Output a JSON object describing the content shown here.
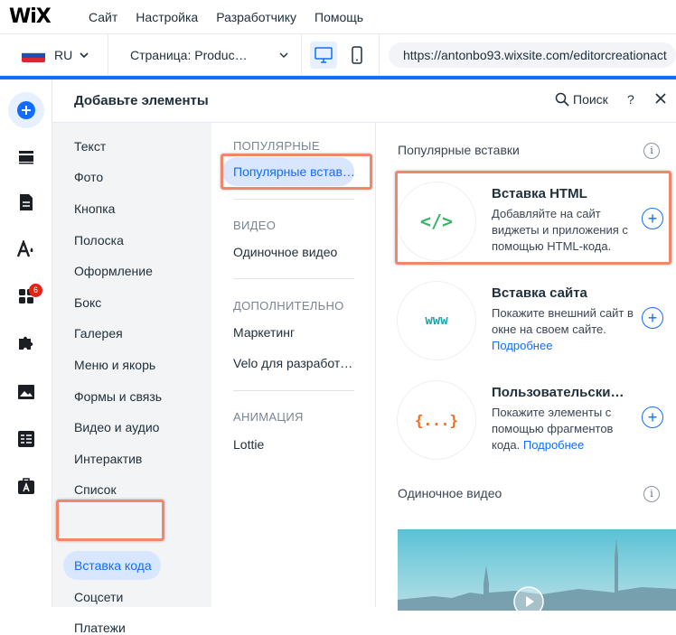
{
  "topbar": {
    "logo": "WiX",
    "menu": [
      "Сайт",
      "Настройка",
      "Разработчику",
      "Помощь"
    ]
  },
  "bar2": {
    "language": "RU",
    "page": "Страница: Produc…",
    "url": "https://antonbo93.wixsite.com/editorcreationact"
  },
  "rail": {
    "apps_badge": "6"
  },
  "panel": {
    "title": "Добавьте элементы",
    "search_label": "Поиск",
    "help_label": "?",
    "categories": [
      "Текст",
      "Фото",
      "Кнопка",
      "Полоска",
      "Оформление",
      "Бокс",
      "Галерея",
      "Меню и якорь",
      "Формы и связь",
      "Видео и аудио",
      "Интерактив",
      "Список",
      "Вставка кода",
      "Соцсети",
      "Платежи"
    ],
    "subcats": {
      "popular_header": "ПОПУЛЯРНЫЕ",
      "popular_item": "Популярные встав…",
      "video_header": "ВИДЕО",
      "video_item": "Одиночное видео",
      "extra_header": "ДОПОЛНИТЕЛЬНО",
      "extra_items": [
        "Маркетинг",
        "Velo для разработ…"
      ],
      "anim_header": "АНИМАЦИЯ",
      "anim_item": "Lottie"
    },
    "content": {
      "section_title": "Популярные вставки",
      "info": "i",
      "cards": [
        {
          "icon": "</>",
          "title": "Вставка HTML",
          "desc": "Добавляйте на сайт виджеты и приложения с помощью HTML-кода.",
          "link": ""
        },
        {
          "icon": "www",
          "title": "Вставка сайта",
          "desc": "Покажите внешний сайт в окне на своем сайте.",
          "link": "Подробнее"
        },
        {
          "icon": "{...}",
          "title": "Пользовательски…",
          "desc": "Покажите элементы с помощью фрагментов кода.",
          "link": "Подробнее"
        }
      ],
      "video_section_title": "Одиночное видео"
    }
  },
  "colors": {
    "accent": "#116dff",
    "highlight": "#f0876a",
    "html_icon": "#3bb36b",
    "www_icon": "#1aa7a8",
    "code_icon": "#f26b1d"
  }
}
